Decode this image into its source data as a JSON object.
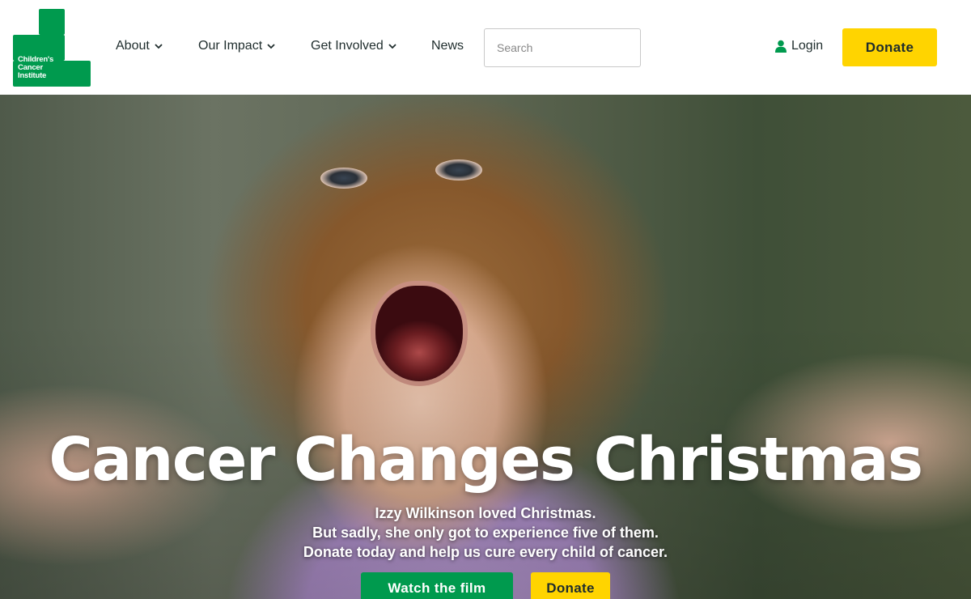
{
  "brand": {
    "logo_lines": [
      "Children's",
      "Cancer",
      "Institute"
    ],
    "colors": {
      "green": "#009a4e",
      "yellow": "#ffd400",
      "text": "#1f2d2d"
    }
  },
  "nav": {
    "items": [
      {
        "label": "About",
        "has_dropdown": true,
        "icon": "chevron-down-icon"
      },
      {
        "label": "Our Impact",
        "has_dropdown": true,
        "icon": "chevron-down-icon"
      },
      {
        "label": "Get Involved",
        "has_dropdown": true,
        "icon": "chevron-down-icon"
      },
      {
        "label": "News",
        "has_dropdown": false
      }
    ],
    "search_placeholder": "Search",
    "search_value": "",
    "login_label": "Login",
    "login_icon": "user-icon",
    "donate_label": "Donate"
  },
  "hero": {
    "title": "Cancer Changes Christmas",
    "subtitle_lines": [
      "Izzy Wilkinson loved Christmas.",
      "But sadly, she only got to experience five of them.",
      "Donate today and help us cure every child of cancer."
    ],
    "watch_label": "Watch the film",
    "donate_label": "Donate"
  }
}
